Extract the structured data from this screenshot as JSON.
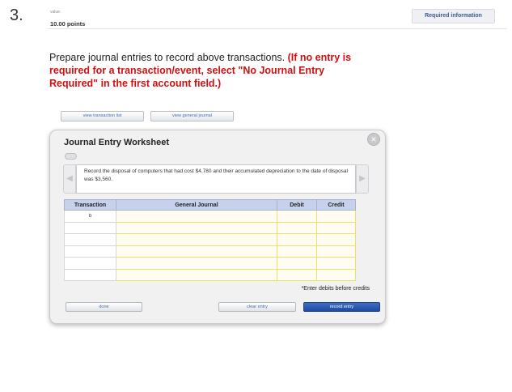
{
  "question": {
    "number": "3.",
    "value_label": "value:",
    "points": "10.00 points",
    "required_info_label": "Required information"
  },
  "prompt": {
    "text": "Prepare journal entries to record above transactions.",
    "emphasis": "(If no entry is required for a transaction/event, select \"No Journal Entry Required\" in the first account field.)"
  },
  "top_buttons": {
    "transaction_list": "view transaction list",
    "general_journal": "view general journal"
  },
  "worksheet": {
    "title": "Journal Entry Worksheet",
    "close_icon": "close-icon",
    "description": "Record the disposal of computers that had cost $4,780 and their accumulated depreciation to the date of disposal was $3,560.",
    "prev_icon": "chevron-left-icon",
    "next_icon": "chevron-right-icon",
    "table": {
      "headers": {
        "transaction": "Transaction",
        "general_journal": "General Journal",
        "debit": "Debit",
        "credit": "Credit"
      },
      "rows": [
        {
          "transaction": "b",
          "account": "",
          "debit": "",
          "credit": ""
        },
        {
          "transaction": "",
          "account": "",
          "debit": "",
          "credit": ""
        },
        {
          "transaction": "",
          "account": "",
          "debit": "",
          "credit": ""
        },
        {
          "transaction": "",
          "account": "",
          "debit": "",
          "credit": ""
        },
        {
          "transaction": "",
          "account": "",
          "debit": "",
          "credit": ""
        },
        {
          "transaction": "",
          "account": "",
          "debit": "",
          "credit": ""
        }
      ]
    },
    "note": "*Enter debits before credits",
    "buttons": {
      "done": "done",
      "clear": "clear entry",
      "record": "record entry"
    }
  },
  "colors": {
    "accent": "#d01010",
    "header_blue": "#c6d2ec",
    "input_border": "#ede16a",
    "primary_button": "#2a56b0"
  }
}
